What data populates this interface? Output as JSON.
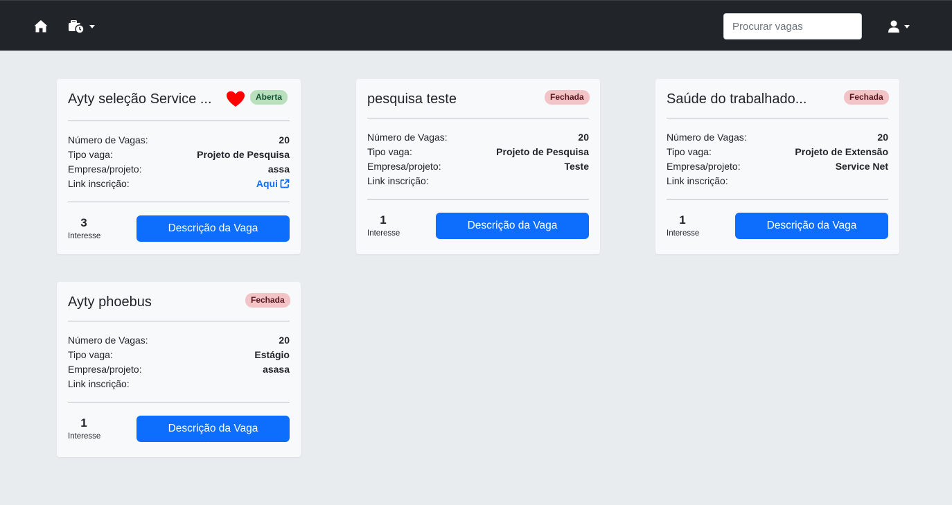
{
  "nav": {
    "search_placeholder": "Procurar vagas"
  },
  "icons": {
    "home": "home-icon",
    "jobs": "briefcase-clock-icon",
    "user": "user-icon",
    "favorite": "heart-icon",
    "external": "external-link-icon"
  },
  "colors": {
    "navbar": "#212529",
    "primary": "#0d6efd",
    "open_badge": "#b9e0bd",
    "closed_badge": "#f2c4c7",
    "heart": "#ff0000"
  },
  "labels": {
    "num_vagas": "Número de Vagas:",
    "tipo_vaga": "Tipo vaga:",
    "empresa": "Empresa/projeto:",
    "link": "Link inscrição:",
    "interest": "Interesse",
    "button": "Descrição da Vaga"
  },
  "cards": [
    {
      "title": "Ayty seleção Service ...",
      "status": "Aberta",
      "favorited": true,
      "num_vagas": "20",
      "tipo": "Projeto de Pesquisa",
      "empresa": "assa",
      "link_text": "Aqui",
      "interest": "3"
    },
    {
      "title": "pesquisa teste",
      "status": "Fechada",
      "favorited": false,
      "num_vagas": "20",
      "tipo": "Projeto de Pesquisa",
      "empresa": "Teste",
      "link_text": "",
      "interest": "1"
    },
    {
      "title": "Saúde do trabalhado...",
      "status": "Fechada",
      "favorited": false,
      "num_vagas": "20",
      "tipo": "Projeto de Extensão",
      "empresa": "Service Net",
      "link_text": "",
      "interest": "1"
    },
    {
      "title": "Ayty phoebus",
      "status": "Fechada",
      "favorited": false,
      "num_vagas": "20",
      "tipo": "Estágio",
      "empresa": "asasa",
      "link_text": "",
      "interest": "1"
    }
  ]
}
